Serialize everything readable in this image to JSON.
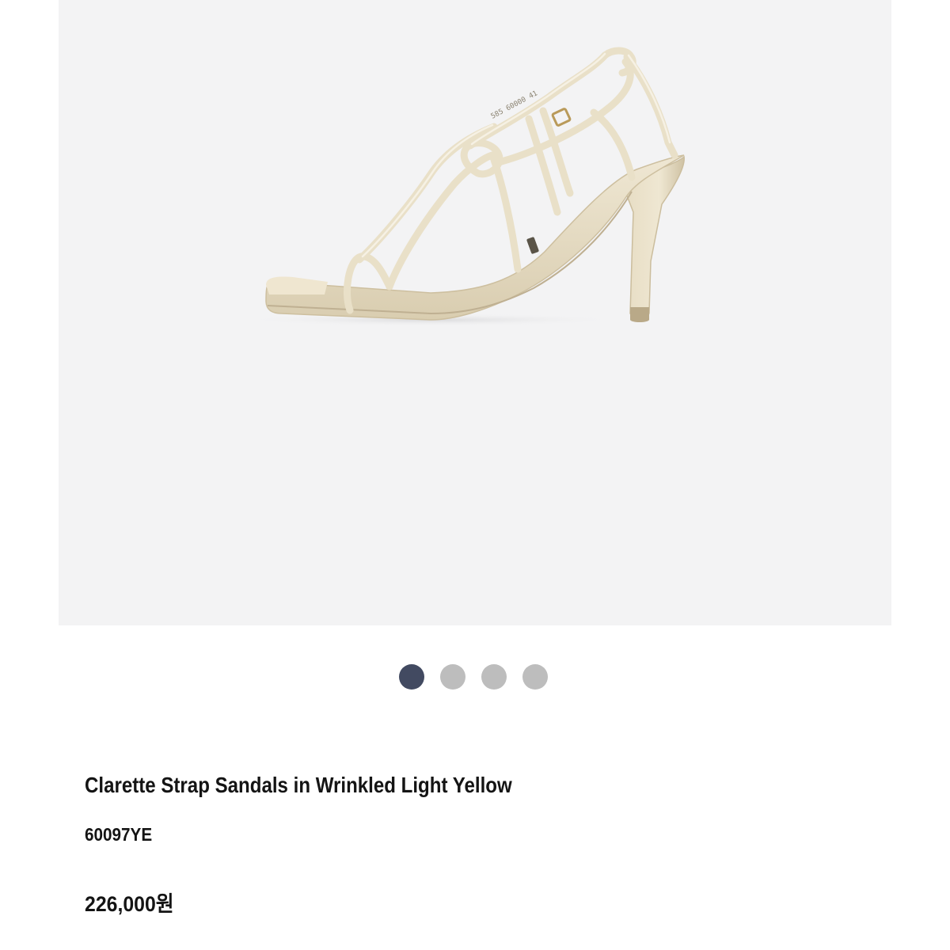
{
  "product": {
    "name": "Clarette Strap Sandals in Wrinkled Light Yellow",
    "code": "60097YE",
    "price": "226,000원",
    "image_description_icon": "sandal-image"
  },
  "carousel": {
    "total_slides": 4,
    "active_index": 0,
    "active_color": "#424a61",
    "inactive_color": "#bdbdbd"
  },
  "colors": {
    "image_background": "#f3f3f4",
    "sandal": "#ebe2cb",
    "text": "#141414"
  }
}
